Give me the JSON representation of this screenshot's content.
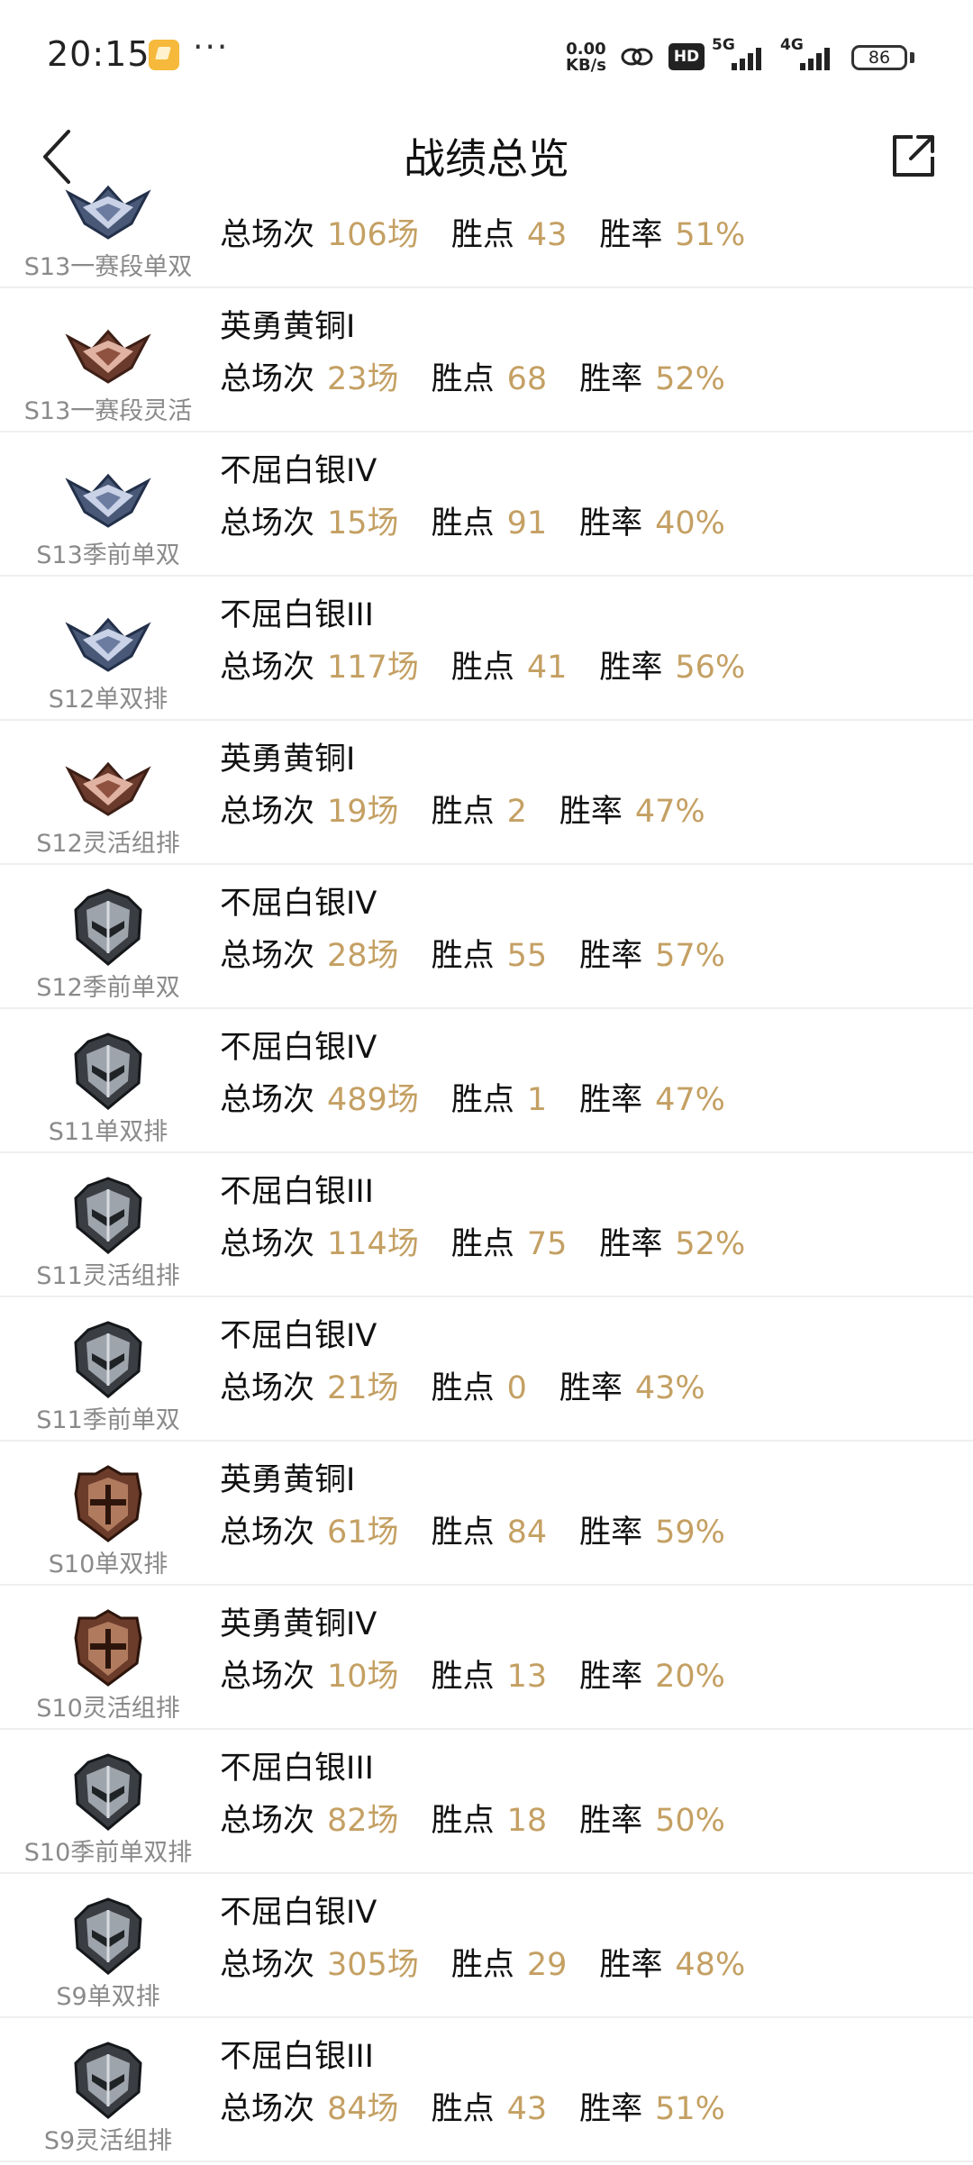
{
  "status": {
    "time": "20:15",
    "speed_value": "0.00",
    "speed_unit": "KB/s",
    "hd": "HD",
    "net1": "5G",
    "net2": "4G",
    "battery": "86"
  },
  "nav": {
    "title": "战绩总览"
  },
  "colors": {
    "accent": "#c4a063",
    "text": "#111111",
    "muted": "#8a8a8a",
    "divider": "#efefef"
  },
  "labels": {
    "games": "总场次",
    "points": "胜点",
    "winrate": "胜率"
  },
  "rows": [
    {
      "season": "S13一赛段单双",
      "rank": "",
      "games": "106场",
      "points": "43",
      "winrate": "51%",
      "emblem": "silver-wings-emblem"
    },
    {
      "season": "S13一赛段灵活",
      "rank": "英勇黄铜I",
      "games": "23场",
      "points": "68",
      "winrate": "52%",
      "emblem": "bronze-wings-emblem"
    },
    {
      "season": "S13季前单双",
      "rank": "不屈白银IV",
      "games": "15场",
      "points": "91",
      "winrate": "40%",
      "emblem": "silver-wings-emblem"
    },
    {
      "season": "S12单双排",
      "rank": "不屈白银III",
      "games": "117场",
      "points": "41",
      "winrate": "56%",
      "emblem": "silver-wings-emblem"
    },
    {
      "season": "S12灵活组排",
      "rank": "英勇黄铜I",
      "games": "19场",
      "points": "2",
      "winrate": "47%",
      "emblem": "bronze-wings-emblem"
    },
    {
      "season": "S12季前单双",
      "rank": "不屈白银IV",
      "games": "28场",
      "points": "55",
      "winrate": "57%",
      "emblem": "silver-helmet-emblem"
    },
    {
      "season": "S11单双排",
      "rank": "不屈白银IV",
      "games": "489场",
      "points": "1",
      "winrate": "47%",
      "emblem": "silver-helmet-emblem"
    },
    {
      "season": "S11灵活组排",
      "rank": "不屈白银III",
      "games": "114场",
      "points": "75",
      "winrate": "52%",
      "emblem": "silver-helmet-emblem"
    },
    {
      "season": "S11季前单双",
      "rank": "不屈白银IV",
      "games": "21场",
      "points": "0",
      "winrate": "43%",
      "emblem": "silver-helmet-emblem"
    },
    {
      "season": "S10单双排",
      "rank": "英勇黄铜I",
      "games": "61场",
      "points": "84",
      "winrate": "59%",
      "emblem": "bronze-helmet-emblem"
    },
    {
      "season": "S10灵活组排",
      "rank": "英勇黄铜IV",
      "games": "10场",
      "points": "13",
      "winrate": "20%",
      "emblem": "bronze-helmet-emblem"
    },
    {
      "season": "S10季前单双排",
      "rank": "不屈白银III",
      "games": "82场",
      "points": "18",
      "winrate": "50%",
      "emblem": "silver-helmet-emblem"
    },
    {
      "season": "S9单双排",
      "rank": "不屈白银IV",
      "games": "305场",
      "points": "29",
      "winrate": "48%",
      "emblem": "silver-helmet-emblem"
    },
    {
      "season": "S9灵活组排",
      "rank": "不屈白银III",
      "games": "84场",
      "points": "43",
      "winrate": "51%",
      "emblem": "silver-helmet-emblem"
    }
  ]
}
